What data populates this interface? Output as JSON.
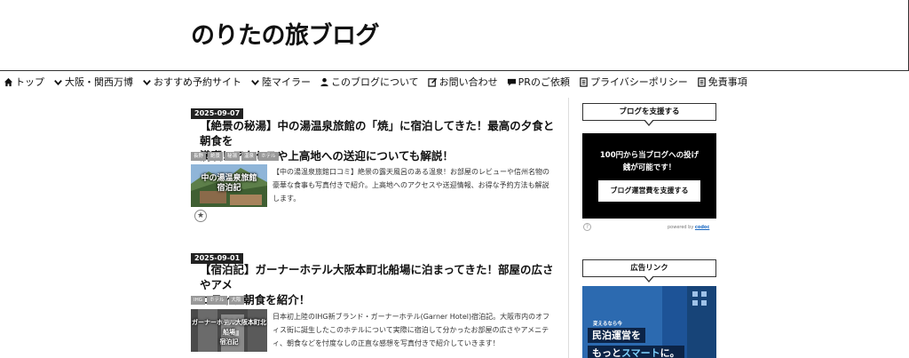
{
  "site": {
    "title": "のりたの旅ブログ"
  },
  "nav": {
    "items": [
      {
        "label": "トップ",
        "icon": "home-icon"
      },
      {
        "label": "大阪・関西万博",
        "icon": "chevron-down-icon"
      },
      {
        "label": "おすすめ予約サイト",
        "icon": "chevron-down-icon"
      },
      {
        "label": "陸マイラー",
        "icon": "chevron-down-icon"
      },
      {
        "label": "このブログについて",
        "icon": "user-icon"
      },
      {
        "label": "お問い合わせ",
        "icon": "edit-icon"
      },
      {
        "label": "PRのご依頼",
        "icon": "comment-icon"
      },
      {
        "label": "プライバシーポリシー",
        "icon": "document-icon"
      },
      {
        "label": "免責事項",
        "icon": "document-icon"
      }
    ]
  },
  "posts": [
    {
      "date": "2025-09-07",
      "title_line1": "【絶景の秘湯】中の湯温泉旅館の「焼」に宿泊してきた！最高の夕食と朝食を",
      "title_line2": "満喫！アクセスや上高地への送迎についても解説！",
      "tags": [
        "長野",
        "絶景",
        "秘湯",
        "温泉",
        "ホテル"
      ],
      "thumb_line1": "中の湯温泉旅館",
      "thumb_line2": "宿泊記",
      "excerpt": "【中の湯温泉旅館口コミ】絶景の露天風呂のある温泉！お部屋のレビューや信州名物の豪華な食事も写真付きで紹介。上高地へのアクセスや送迎情報、お得な予約方法も解説します。"
    },
    {
      "date": "2025-09-01",
      "title_line1": "【宿泊記】ガーナーホテル大阪本町北船場に泊まってきた！部屋の広さやアメ",
      "title_line2": "ニティ、朝食を紹介！",
      "tags": [
        "IHG",
        "ホテル",
        "大阪"
      ],
      "thumb_line1": "ガーナーホテル大阪本町北船場",
      "thumb_line2": "宿泊記",
      "excerpt": "日本初上陸のIHG新ブランド・ガーナーホテル(Garner Hotel)宿泊記。大阪市内のオフィス街に誕生したこのホテルについて実際に宿泊して分かったお部屋の広さやアメニティ、朝食などを忖度なしの正直な感想を写真付きで紹介していきます！"
    }
  ],
  "sidebar": {
    "support_heading": "ブログを支援する",
    "support_text_line1": "100円から当ブログへの投げ",
    "support_text_line2": "銭が可能です！",
    "support_button": "ブログ運営費を支援する",
    "help_icon": "?",
    "powered_prefix": "powered by",
    "powered_brand": "codoc",
    "ad_heading": "広告リンク",
    "ad_small": "変えるなら今",
    "ad_line1": "民泊運営を",
    "ad_line2_prefix": "もっと",
    "ad_line2_highlight": "スマート",
    "ad_line2_suffix": "に。"
  }
}
